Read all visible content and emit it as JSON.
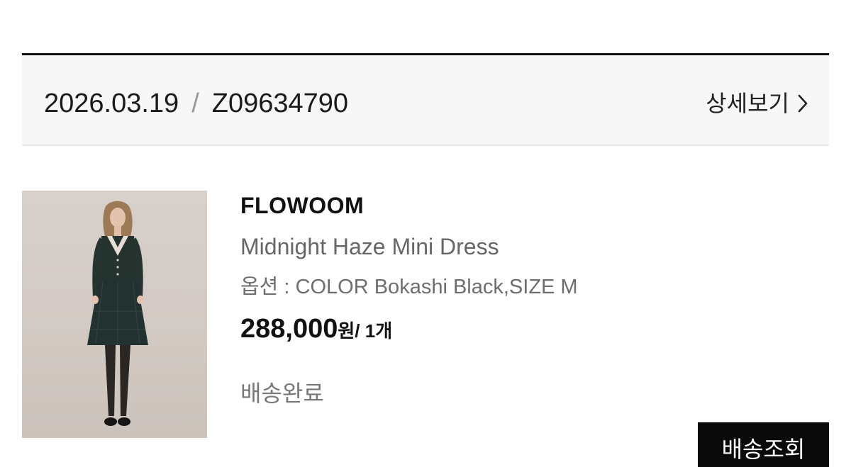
{
  "order": {
    "date": "2026.03.19",
    "separator": "/",
    "number": "Z09634790",
    "detail_link_label": "상세보기"
  },
  "product": {
    "brand": "FLOWOOM",
    "name": "Midnight Haze Mini Dress",
    "option": "옵션 : COLOR Bokashi Black,SIZE M",
    "price": "288,000",
    "currency": "원",
    "quantity": "/ 1개",
    "image_alt": "product-photo"
  },
  "status": "배송완료",
  "actions": {
    "track_label": "배송조회"
  },
  "colors": {
    "button_bg": "#0a0a0a",
    "header_bg": "#f7f7f7",
    "text_muted": "#777777"
  }
}
